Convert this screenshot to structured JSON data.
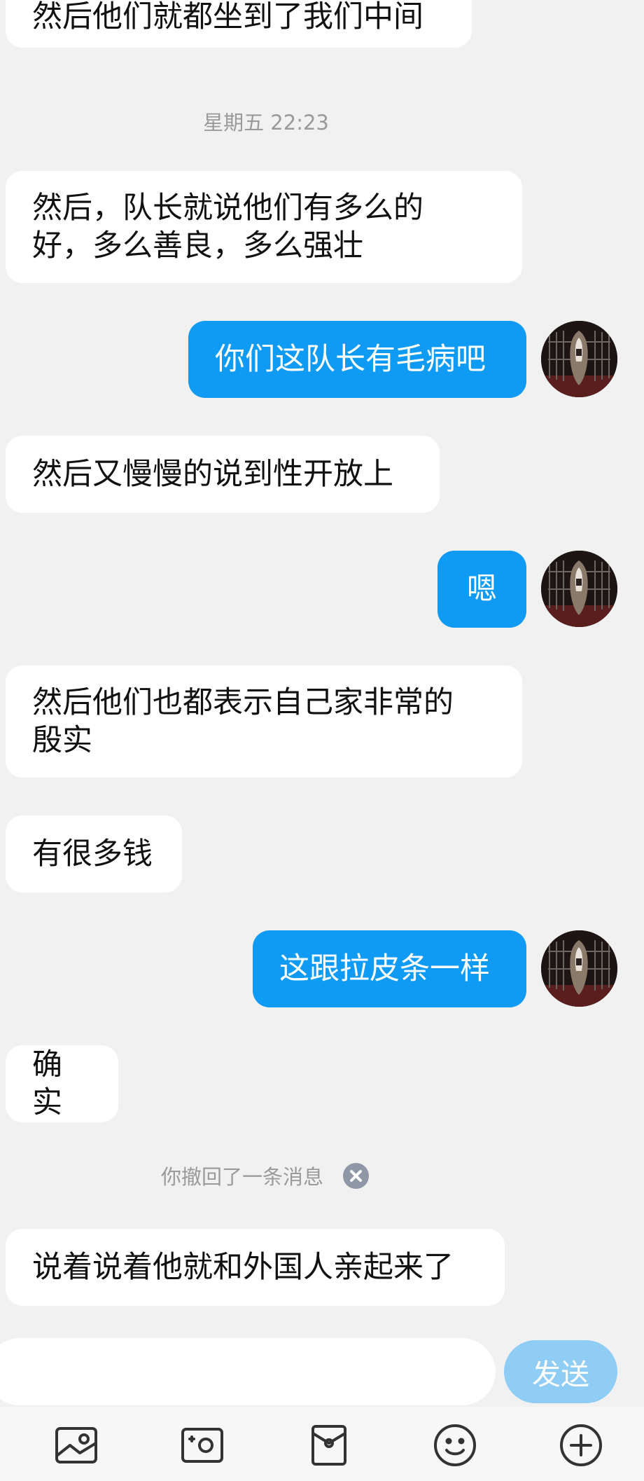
{
  "conversation": {
    "timestamp": "星期五 22:23",
    "recall_notice": "你撤回了一条消息",
    "messages": [
      {
        "side": "left",
        "text": "然后他们就都坐到了我们中间"
      },
      {
        "side": "left",
        "line1": "然后，队长就说他们有多么的",
        "line2": "好，多么善良，多么强壮"
      },
      {
        "side": "right",
        "text": "你们这队长有毛病吧"
      },
      {
        "side": "left",
        "text": "然后又慢慢的说到性开放上"
      },
      {
        "side": "right",
        "text": "嗯"
      },
      {
        "side": "left",
        "line1": "然后他们也都表示自己家非常的",
        "line2": "殷实"
      },
      {
        "side": "left",
        "text": "有很多钱"
      },
      {
        "side": "right",
        "text": "这跟拉皮条一样"
      },
      {
        "side": "left",
        "text": "确实"
      },
      {
        "side": "left",
        "text": "说着说着他就和外国人亲起来了"
      }
    ]
  },
  "composer": {
    "input_value": "",
    "send_label": "发送"
  },
  "toolbar": {
    "icons": [
      "image-icon",
      "camera-icon",
      "red-packet-icon",
      "emoji-icon",
      "plus-icon"
    ]
  },
  "colors": {
    "background": "#f1f1f1",
    "sent_bubble": "#0f9bf4",
    "received_bubble": "#ffffff",
    "send_button": "#8fcdf5"
  }
}
